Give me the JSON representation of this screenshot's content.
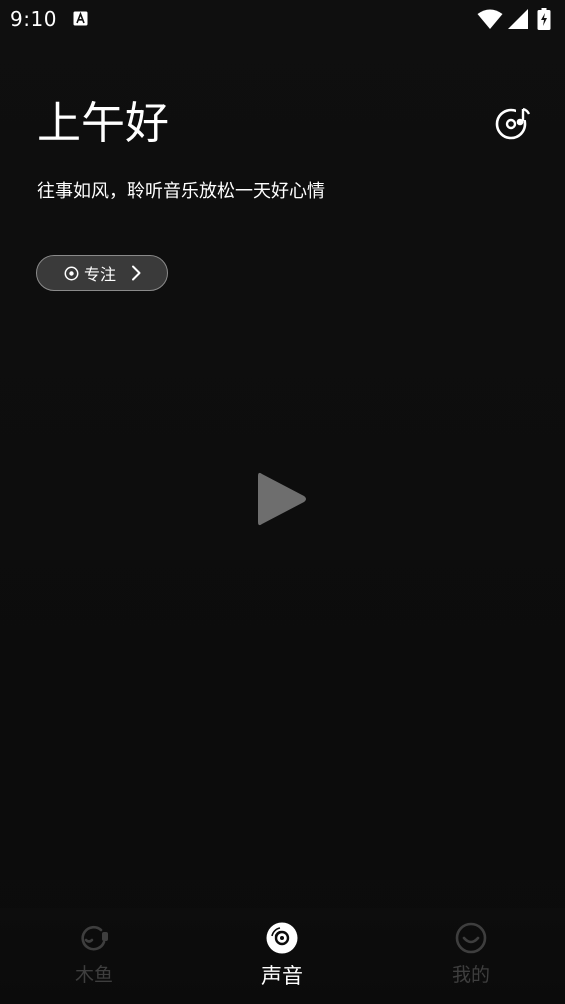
{
  "status_bar": {
    "time": "9:10",
    "icons": [
      "notification-a-icon",
      "wifi-icon",
      "signal-icon",
      "battery-charging-icon"
    ]
  },
  "header": {
    "greeting": "上午好",
    "subtitle": "往事如风，聆听音乐放松一天好心情",
    "music_icon": "music-disc-icon"
  },
  "focus_button": {
    "label": "专注",
    "icon": "target-icon"
  },
  "player": {
    "play_icon": "play-icon"
  },
  "bottom_nav": {
    "items": [
      {
        "label": "木鱼",
        "icon": "wooden-fish-icon",
        "active": false
      },
      {
        "label": "声音",
        "icon": "disc-icon",
        "active": true
      },
      {
        "label": "我的",
        "icon": "smiley-icon",
        "active": false
      }
    ]
  },
  "colors": {
    "background": "#0b0b0b",
    "text": "#ffffff",
    "inactive": "#3e3e3e",
    "play": "#6e6e6e",
    "pill": "#3a3a3a"
  }
}
